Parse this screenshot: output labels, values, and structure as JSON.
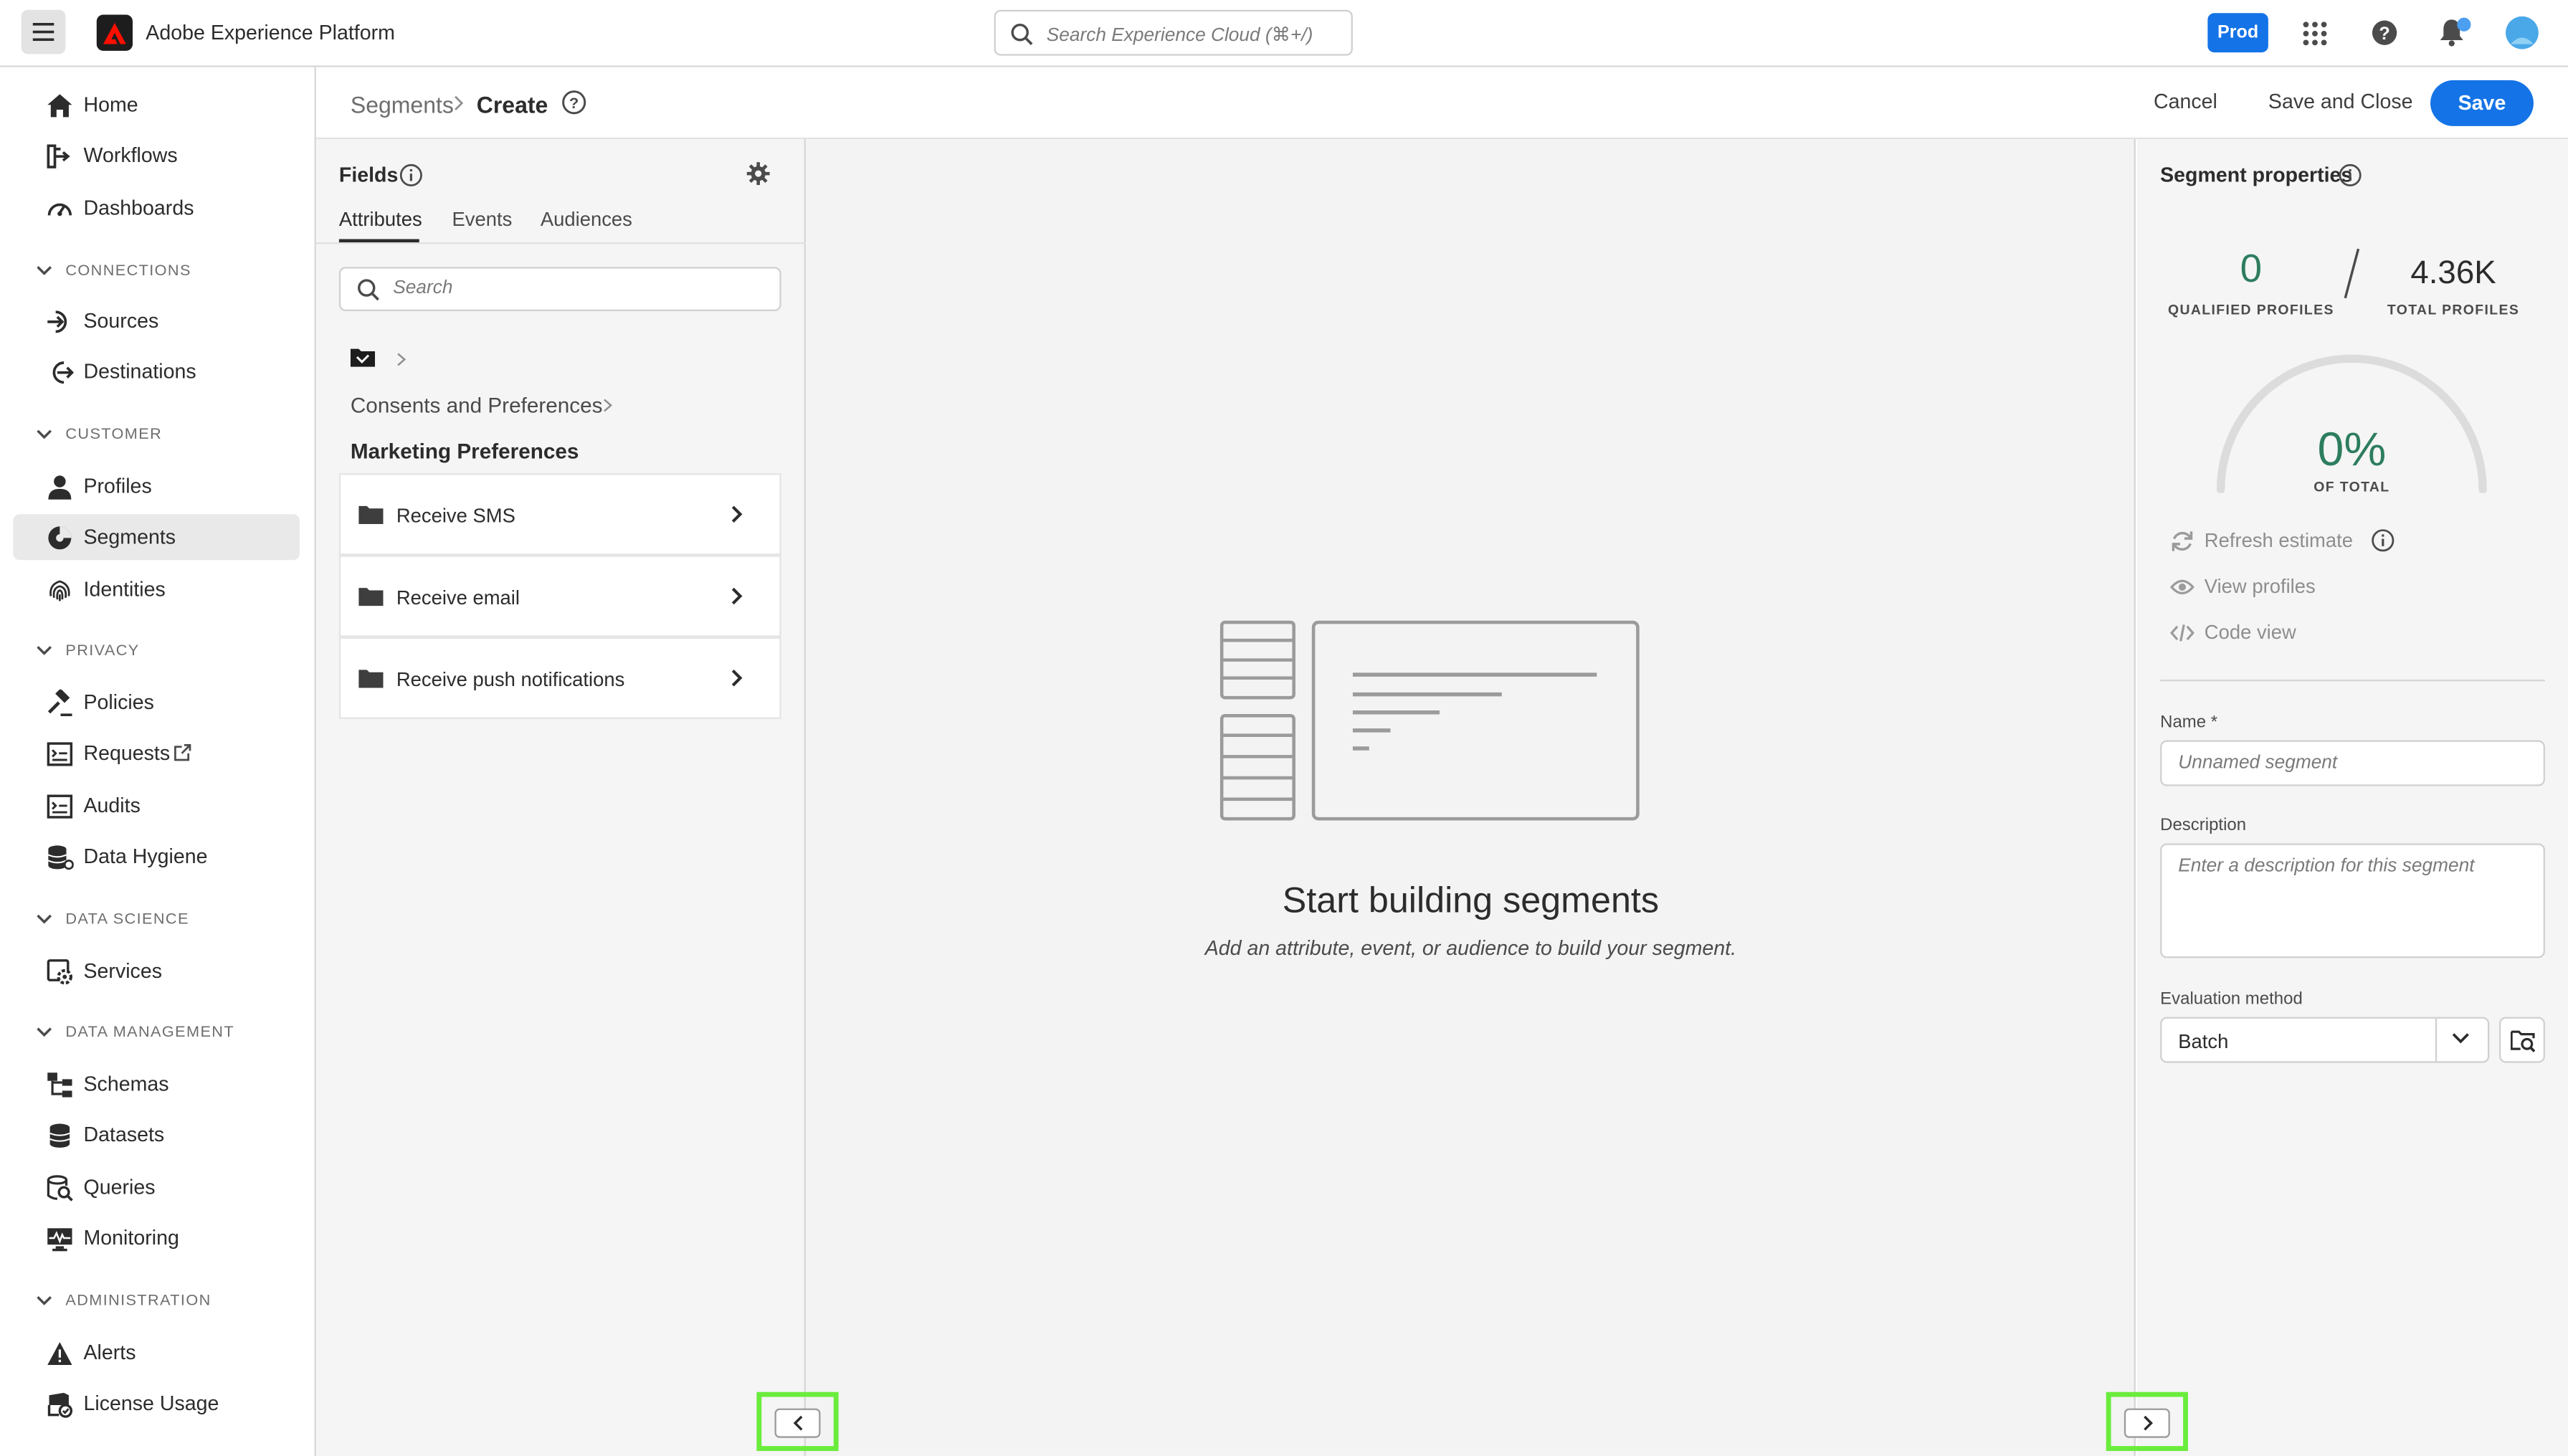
{
  "app": {
    "title": "Adobe Experience Platform"
  },
  "topbar": {
    "search_placeholder": "Search Experience Cloud (⌘+/)",
    "sandbox_badge": "Prod"
  },
  "sidebar": {
    "items": [
      {
        "label": "Home",
        "icon": "home-icon"
      },
      {
        "label": "Workflows",
        "icon": "workflows-icon"
      },
      {
        "label": "Dashboards",
        "icon": "dashboards-icon"
      }
    ],
    "sections": [
      {
        "title": "CONNECTIONS",
        "items": [
          {
            "label": "Sources"
          },
          {
            "label": "Destinations"
          }
        ]
      },
      {
        "title": "CUSTOMER",
        "items": [
          {
            "label": "Profiles"
          },
          {
            "label": "Segments",
            "active": true
          },
          {
            "label": "Identities"
          }
        ]
      },
      {
        "title": "PRIVACY",
        "items": [
          {
            "label": "Policies"
          },
          {
            "label": "Requests"
          },
          {
            "label": "Audits"
          },
          {
            "label": "Data Hygiene"
          }
        ]
      },
      {
        "title": "DATA SCIENCE",
        "items": [
          {
            "label": "Services"
          }
        ]
      },
      {
        "title": "DATA MANAGEMENT",
        "items": [
          {
            "label": "Schemas"
          },
          {
            "label": "Datasets"
          },
          {
            "label": "Queries"
          },
          {
            "label": "Monitoring"
          }
        ]
      },
      {
        "title": "ADMINISTRATION",
        "items": [
          {
            "label": "Alerts"
          },
          {
            "label": "License Usage"
          }
        ]
      }
    ]
  },
  "breadcrumb": {
    "parent": "Segments",
    "current": "Create"
  },
  "actions": {
    "cancel": "Cancel",
    "save_close": "Save and Close",
    "save": "Save"
  },
  "fields_panel": {
    "title": "Fields",
    "tabs": [
      "Attributes",
      "Events",
      "Audiences"
    ],
    "search_placeholder": "Search",
    "path_parent": "Consents and Preferences",
    "path_current": "Marketing Preferences",
    "rows": [
      "Receive SMS",
      "Receive email",
      "Receive push notifications"
    ]
  },
  "canvas": {
    "empty_title": "Start building segments",
    "empty_subtitle": "Add an attribute, event, or audience to build your segment."
  },
  "properties": {
    "title": "Segment properties",
    "qualified_value": "0",
    "qualified_label": "QUALIFIED PROFILES",
    "total_value": "4.36K",
    "total_label": "TOTAL PROFILES",
    "percent_value": "0%",
    "percent_label": "OF TOTAL",
    "percent_fraction": 0,
    "links": [
      "Refresh estimate",
      "View profiles",
      "Code view"
    ],
    "name_label": "Name *",
    "name_placeholder": "Unnamed segment",
    "description_label": "Description",
    "description_placeholder": "Enter a description for this segment",
    "evaluation_label": "Evaluation method",
    "evaluation_value": "Batch"
  },
  "colors": {
    "accent": "#1473e6",
    "positive": "#2d7d5f",
    "highlight": "#6aec3c"
  }
}
